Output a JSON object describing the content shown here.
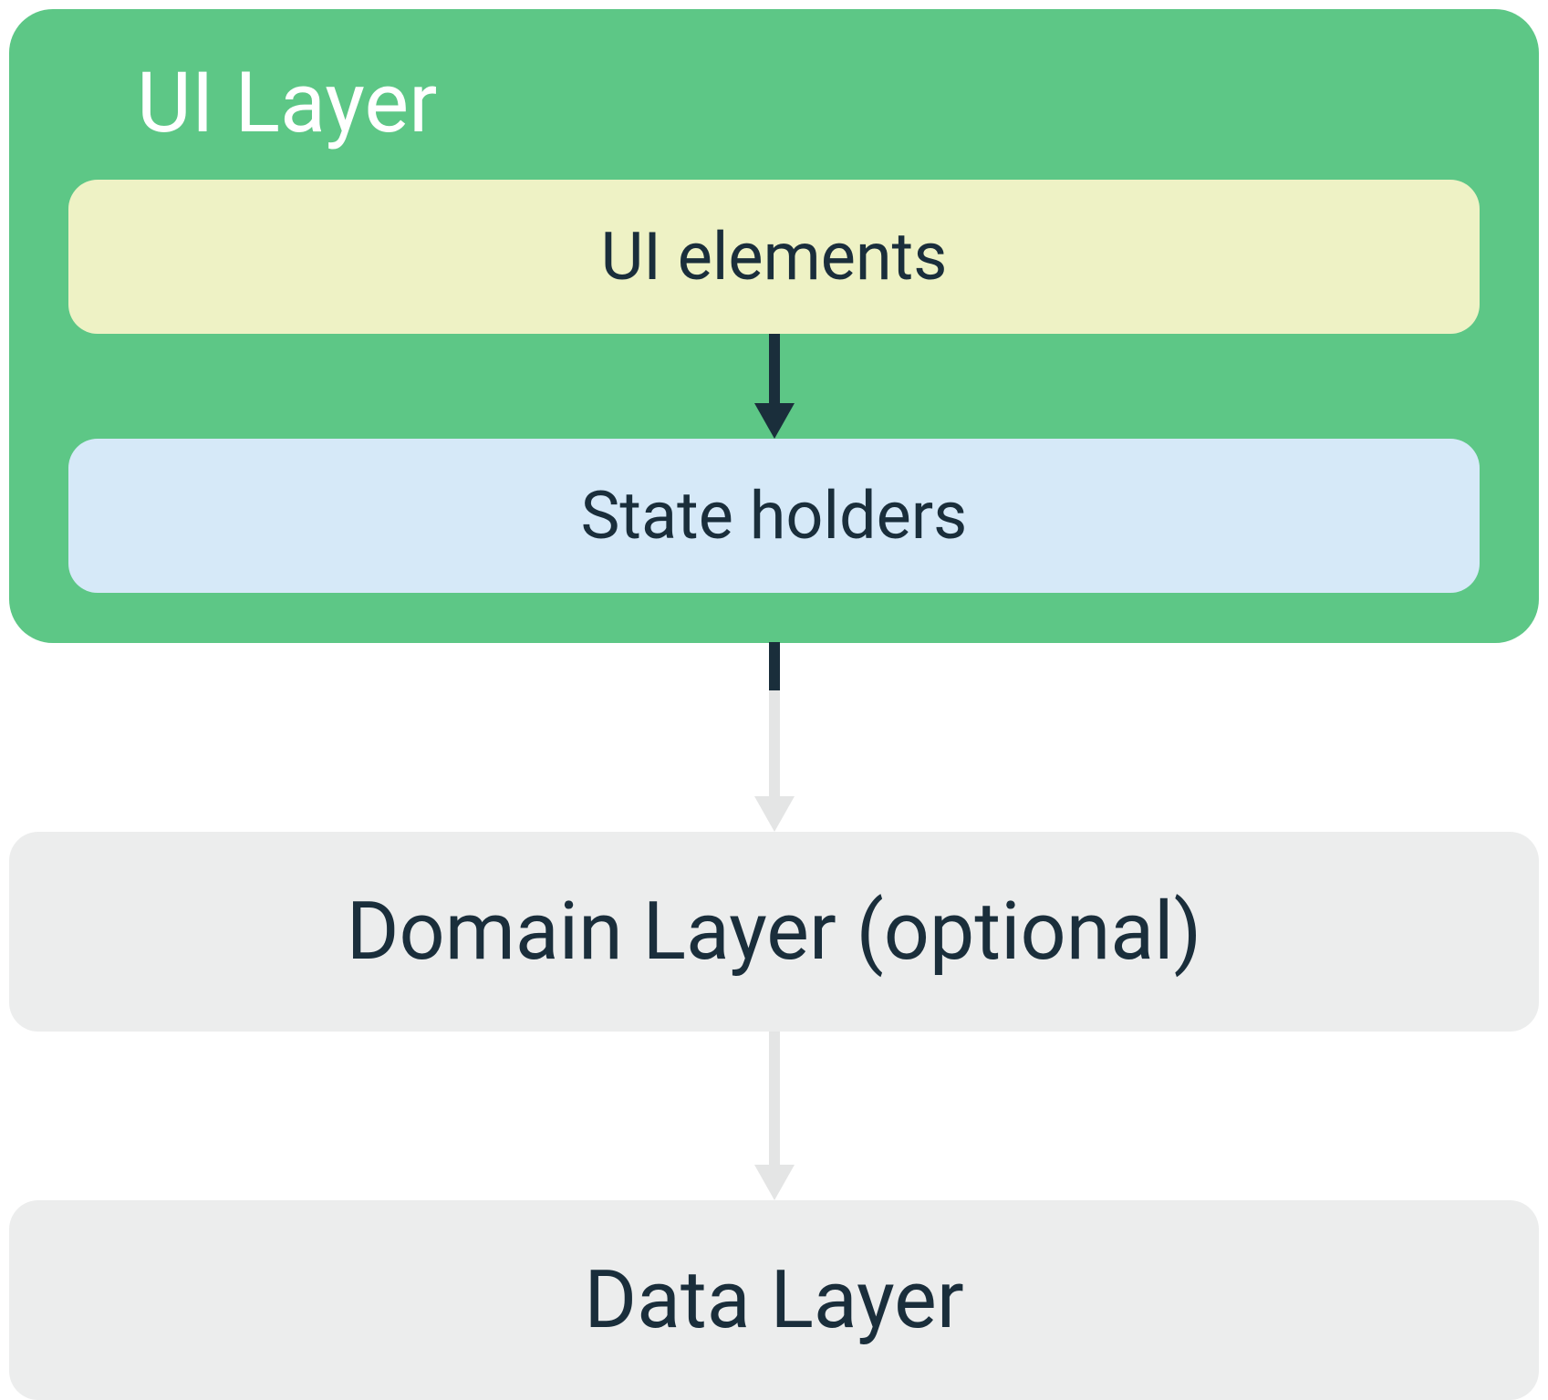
{
  "diagram": {
    "ui_layer": {
      "title": "UI Layer",
      "ui_elements_label": "UI elements",
      "state_holders_label": "State holders"
    },
    "domain_layer_label": "Domain Layer (optional)",
    "data_layer_label": "Data Layer"
  },
  "colors": {
    "ui_layer_bg": "#5dc786",
    "ui_elements_bg": "#eef2c5",
    "state_holders_bg": "#d6e9f8",
    "layer_box_bg": "#eceded",
    "text_dark": "#1a2e3b",
    "arrow_dark": "#1a2e3b",
    "arrow_light": "#e4e5e5"
  }
}
